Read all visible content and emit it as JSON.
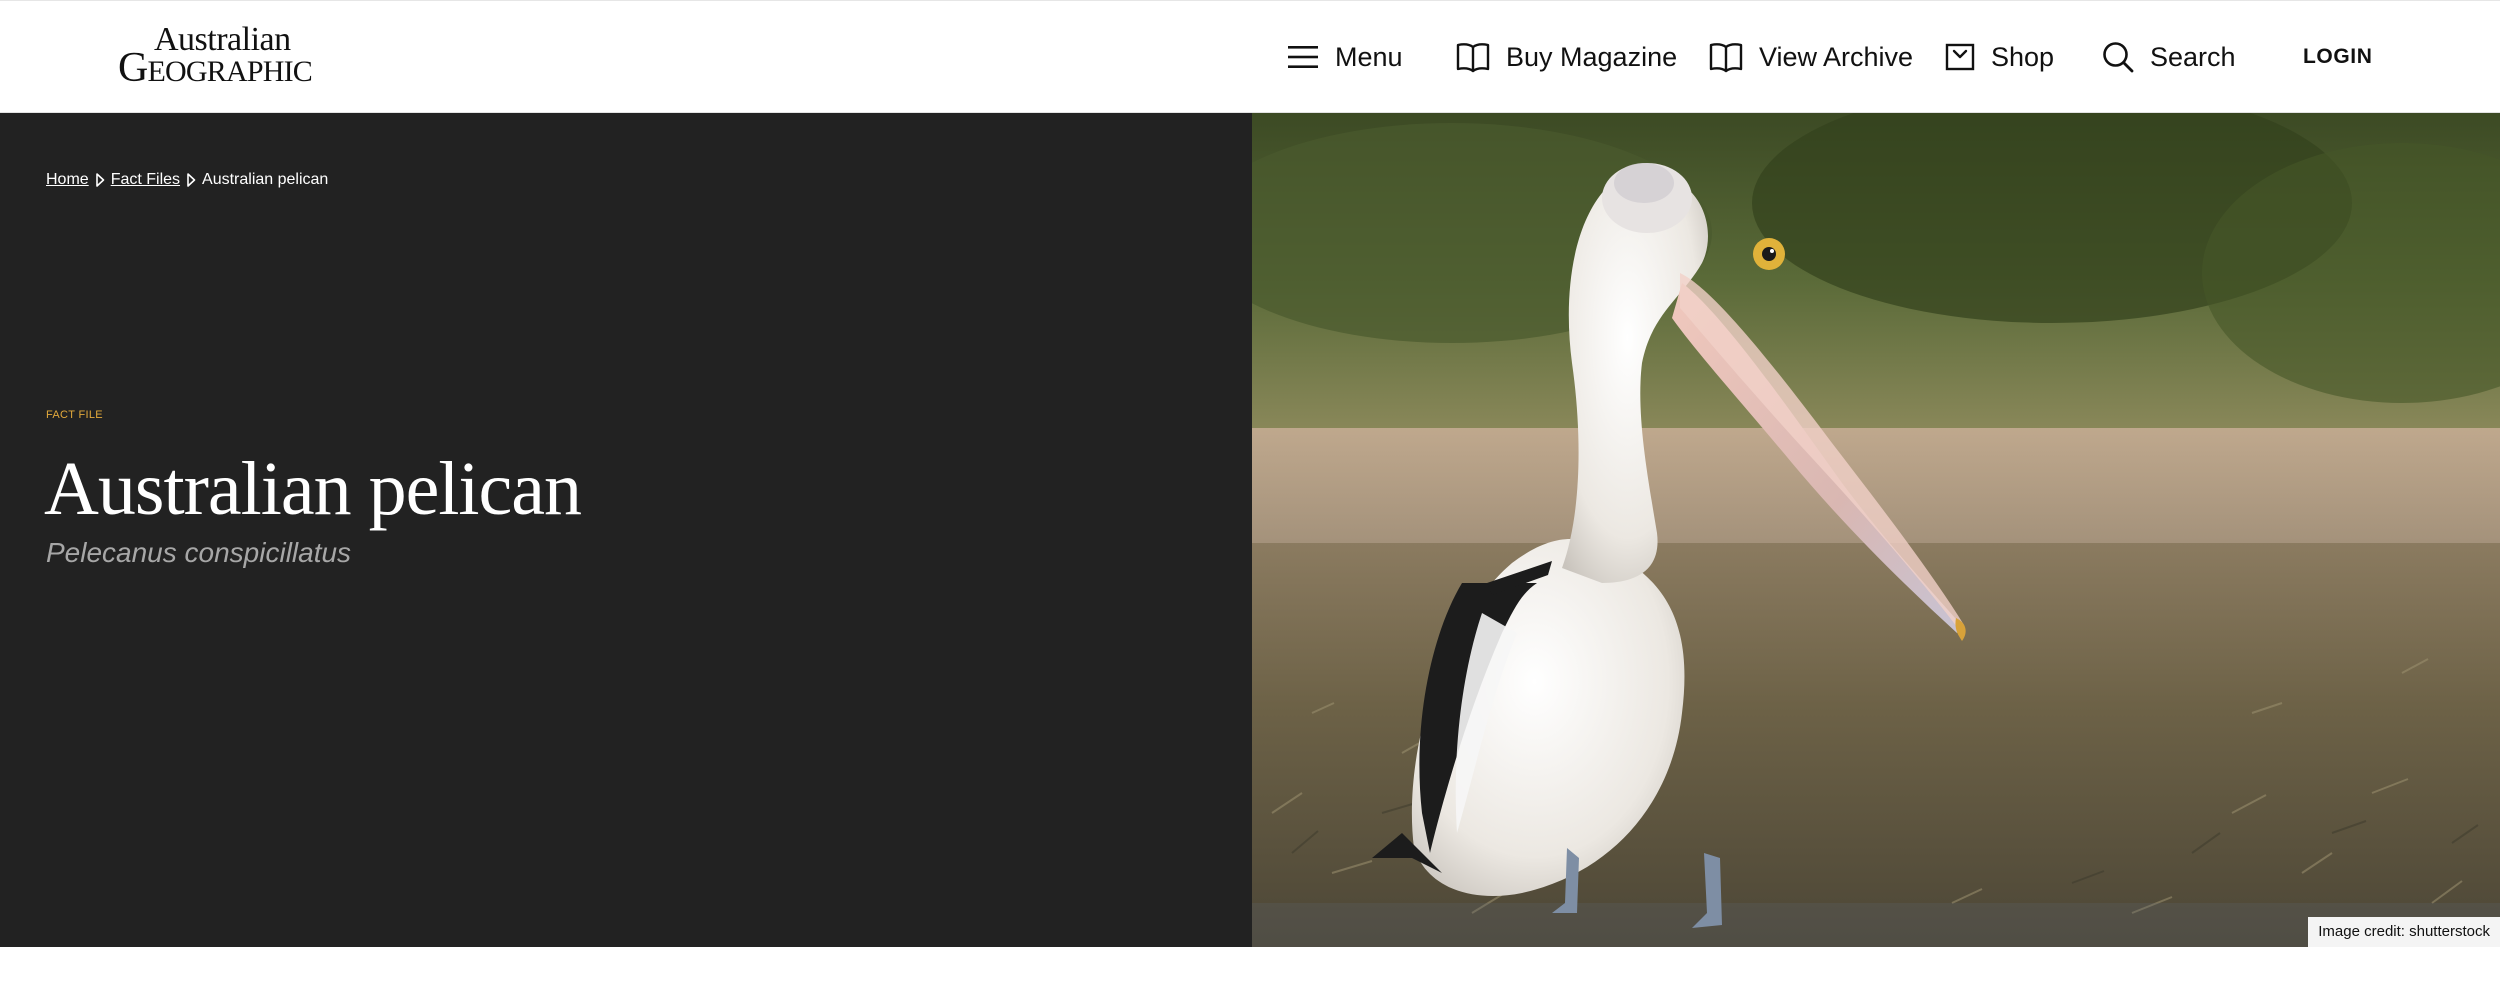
{
  "brand": {
    "line1": "Australian",
    "line2_initial": "G",
    "line2_rest": "EOGRAPHIC"
  },
  "nav": [
    {
      "label": "Menu",
      "icon": "menu-icon"
    },
    {
      "label": "Buy Magazine",
      "icon": "book-icon"
    },
    {
      "label": "View Archive",
      "icon": "book-icon"
    },
    {
      "label": "Shop",
      "icon": "shopping-bag-icon"
    },
    {
      "label": "Search",
      "icon": "search-icon"
    }
  ],
  "login_label": "LOGIN",
  "breadcrumb": {
    "home": "Home",
    "section": "Fact Files",
    "current": "Australian pelican"
  },
  "hero": {
    "kicker": "FACT FILE",
    "title": "Australian pelican",
    "scientific_name": "Pelecanus conspicillatus",
    "image_credit": "Image credit: shutterstock"
  },
  "colors": {
    "hero_bg": "#222222",
    "kicker": "#e3a93b",
    "subtitle": "#a7a7a7"
  }
}
